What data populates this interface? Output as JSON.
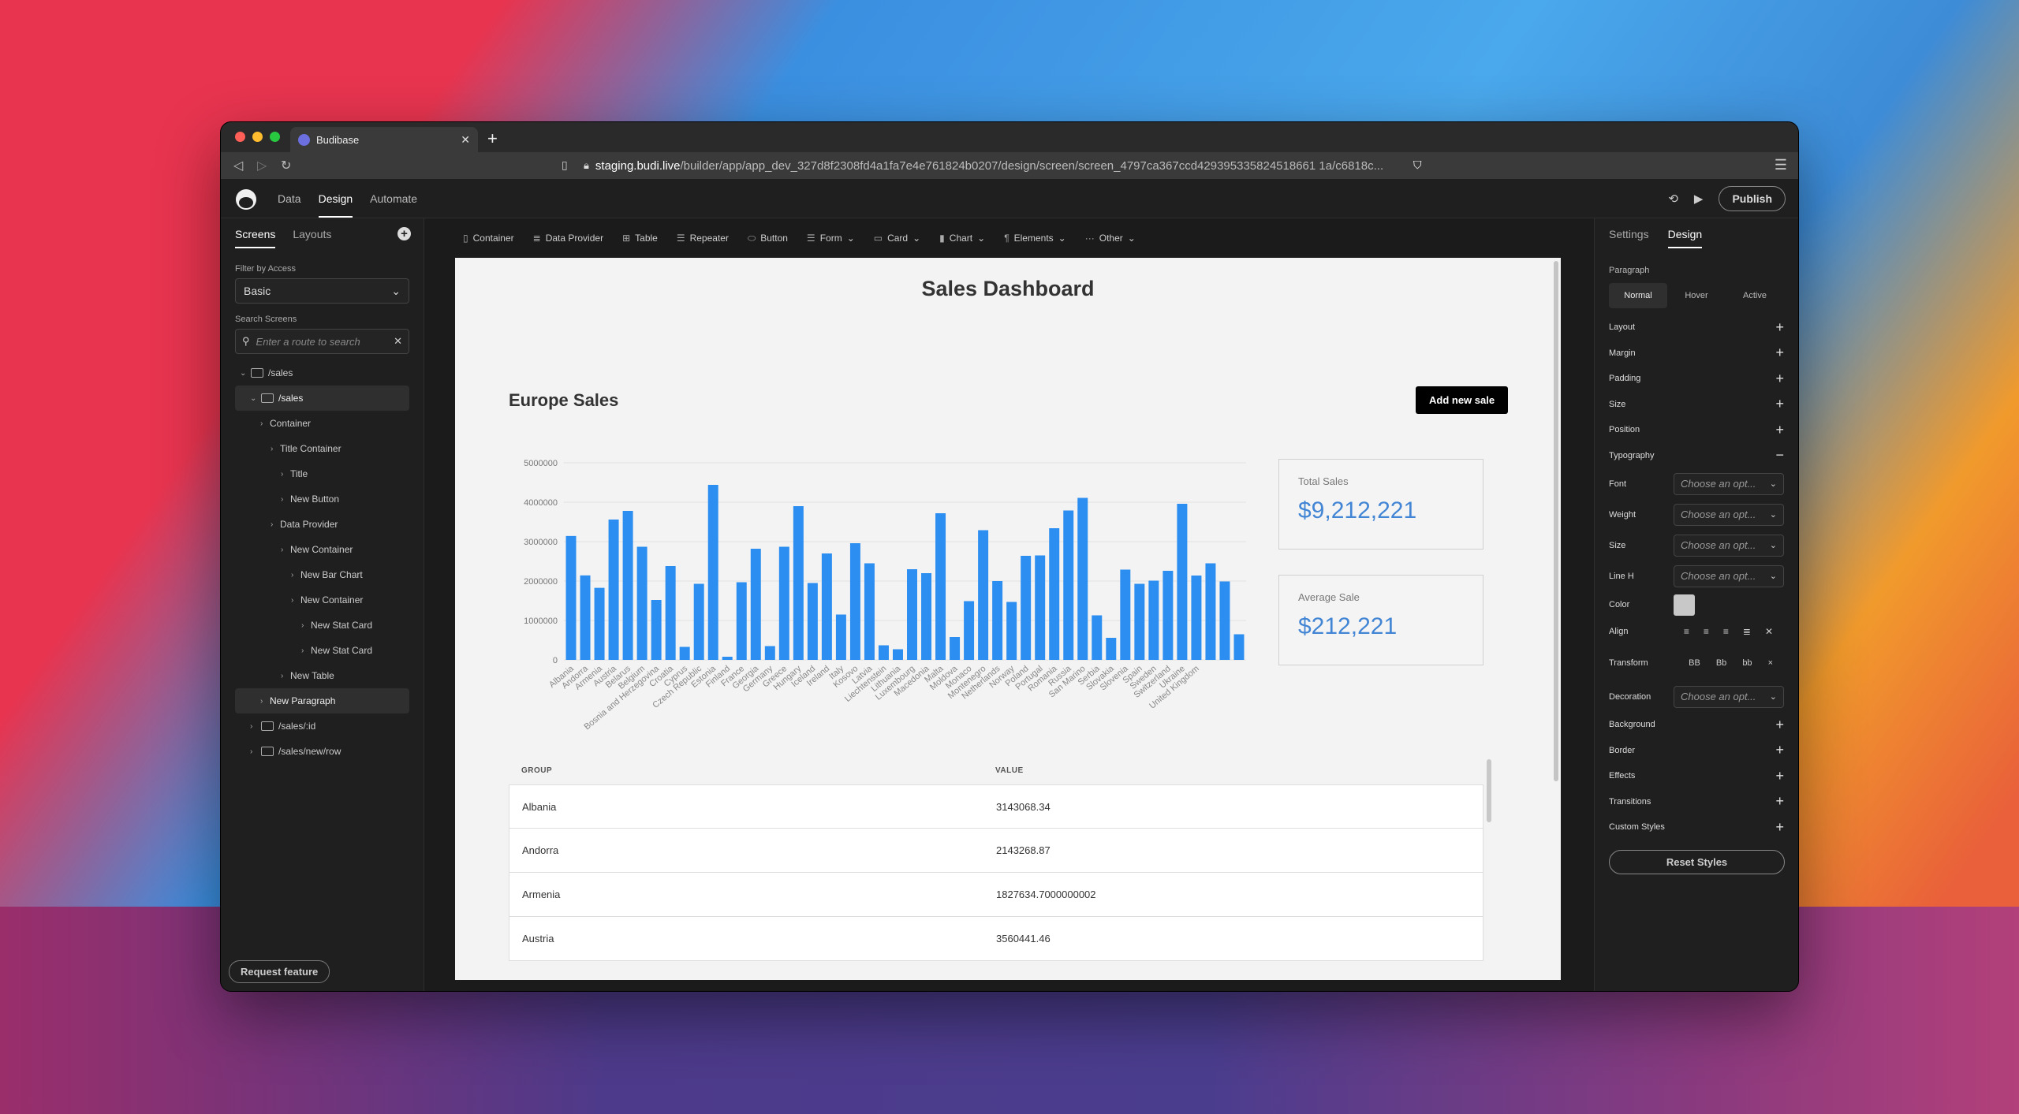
{
  "browser": {
    "tab_title": "Budibase",
    "url_host": "staging.budi.live",
    "url_path": "/builder/app/app_dev_327d8f2308fd4a1fa7e4e761824b0207/design/screen/screen_4797ca367ccd429395335824518661 1a/c6818c..."
  },
  "app": {
    "nav": [
      "Data",
      "Design",
      "Automate"
    ],
    "publish_label": "Publish"
  },
  "left_panel": {
    "tabs": [
      "Screens",
      "Layouts"
    ],
    "filter_label": "Filter by Access",
    "filter_value": "Basic",
    "search_label": "Search Screens",
    "search_placeholder": "Enter a route to search",
    "tree": [
      {
        "label": "/sales",
        "depth": 0,
        "open": true,
        "icon": "folder"
      },
      {
        "label": "/sales",
        "depth": 1,
        "open": true,
        "icon": "screen",
        "selected": true
      },
      {
        "label": "Container",
        "depth": 2
      },
      {
        "label": "Title Container",
        "depth": 3
      },
      {
        "label": "Title",
        "depth": 4
      },
      {
        "label": "New Button",
        "depth": 4
      },
      {
        "label": "Data Provider",
        "depth": 3
      },
      {
        "label": "New Container",
        "depth": 4
      },
      {
        "label": "New Bar Chart",
        "depth": 5
      },
      {
        "label": "New Container",
        "depth": 5
      },
      {
        "label": "New Stat Card",
        "depth": 6
      },
      {
        "label": "New Stat Card",
        "depth": 6
      },
      {
        "label": "New Table",
        "depth": 4
      },
      {
        "label": "New Paragraph",
        "depth": 2,
        "selected": true
      },
      {
        "label": "/sales/:id",
        "depth": 1,
        "icon": "screen"
      },
      {
        "label": "/sales/new/row",
        "depth": 1,
        "icon": "screen"
      }
    ],
    "request_feature": "Request feature"
  },
  "toolbar": {
    "items": [
      {
        "label": "Container",
        "icon": "container-icon"
      },
      {
        "label": "Data Provider",
        "icon": "database-icon"
      },
      {
        "label": "Table",
        "icon": "table-icon"
      },
      {
        "label": "Repeater",
        "icon": "list-icon"
      },
      {
        "label": "Button",
        "icon": "button-icon"
      },
      {
        "label": "Form",
        "icon": "form-icon",
        "dropdown": true
      },
      {
        "label": "Card",
        "icon": "card-icon",
        "dropdown": true
      },
      {
        "label": "Chart",
        "icon": "chart-icon",
        "dropdown": true
      },
      {
        "label": "Elements",
        "icon": "paragraph-icon",
        "dropdown": true
      },
      {
        "label": "Other",
        "icon": "more-icon",
        "dropdown": true
      }
    ]
  },
  "canvas": {
    "page_title": "Sales Dashboard",
    "section_title": "Europe Sales",
    "add_button": "Add new sale",
    "stats": [
      {
        "label": "Total Sales",
        "value": "$9,212,221"
      },
      {
        "label": "Average Sale",
        "value": "$212,221"
      }
    ],
    "table": {
      "columns": [
        "GROUP",
        "VALUE"
      ],
      "rows": [
        [
          "Albania",
          "3143068.34"
        ],
        [
          "Andorra",
          "2143268.87"
        ],
        [
          "Armenia",
          "1827634.7000000002"
        ],
        [
          "Austria",
          "3560441.46"
        ]
      ]
    }
  },
  "chart_data": {
    "type": "bar",
    "ylim": [
      0,
      5000000
    ],
    "yticks": [
      "0",
      "1000000",
      "2000000",
      "3000000",
      "4000000",
      "5000000"
    ],
    "categories": [
      "Albania",
      "Andorra",
      "Armenia",
      "Austria",
      "Belarus",
      "Belgium",
      "Bosnia and Herzegovina",
      "Croatia",
      "Cyprus",
      "Czech Republic",
      "Estonia",
      "Finland",
      "France",
      "Georgia",
      "Germany",
      "Greece",
      "Hungary",
      "Iceland",
      "Ireland",
      "Italy",
      "Kosovo",
      "Latvia",
      "Liechtenstein",
      "Lithuania",
      "Luxembourg",
      "Macedonia",
      "Malta",
      "Moldova",
      "Monaco",
      "Montenegro",
      "Netherlands",
      "Norway",
      "Poland",
      "Portugal",
      "Romania",
      "Russia",
      "San Marino",
      "Serbia",
      "Slovakia",
      "Slovenia",
      "Spain",
      "Sweden",
      "Switzerland",
      "Ukraine",
      "United Kingdom"
    ],
    "values": [
      3143068,
      2143268,
      1827634,
      3560441,
      3780000,
      2870000,
      1520000,
      2380000,
      330000,
      1930000,
      4440000,
      80000,
      1970000,
      2820000,
      350000,
      2870000,
      3900000,
      1950000,
      2700000,
      1150000,
      2960000,
      2450000,
      370000,
      270000,
      2300000,
      2200000,
      3720000,
      580000,
      1490000,
      3290000,
      2000000,
      1470000,
      2640000,
      2650000,
      3340000,
      3790000,
      4110000,
      1130000,
      560000,
      2290000,
      1930000,
      2010000,
      2260000,
      3960000,
      2140000,
      2450000,
      1990000,
      650000
    ],
    "label_every": 1
  },
  "right_panel": {
    "tabs": [
      "Settings",
      "Design"
    ],
    "component": "Paragraph",
    "states": [
      "Normal",
      "Hover",
      "Active"
    ],
    "sections_top": [
      "Layout",
      "Margin",
      "Padding",
      "Size",
      "Position"
    ],
    "typography": "Typography",
    "fields": [
      {
        "label": "Font",
        "placeholder": "Choose an opt..."
      },
      {
        "label": "Weight",
        "placeholder": "Choose an opt..."
      },
      {
        "label": "Size",
        "placeholder": "Choose an opt..."
      },
      {
        "label": "Line H",
        "placeholder": "Choose an opt..."
      }
    ],
    "color_label": "Color",
    "align_label": "Align",
    "transform_label": "Transform",
    "transform_options": [
      "BB",
      "Bb",
      "bb",
      "×"
    ],
    "decoration_label": "Decoration",
    "decoration_placeholder": "Choose an opt...",
    "sections_bottom": [
      "Background",
      "Border",
      "Effects",
      "Transitions",
      "Custom Styles"
    ],
    "reset_label": "Reset Styles"
  }
}
